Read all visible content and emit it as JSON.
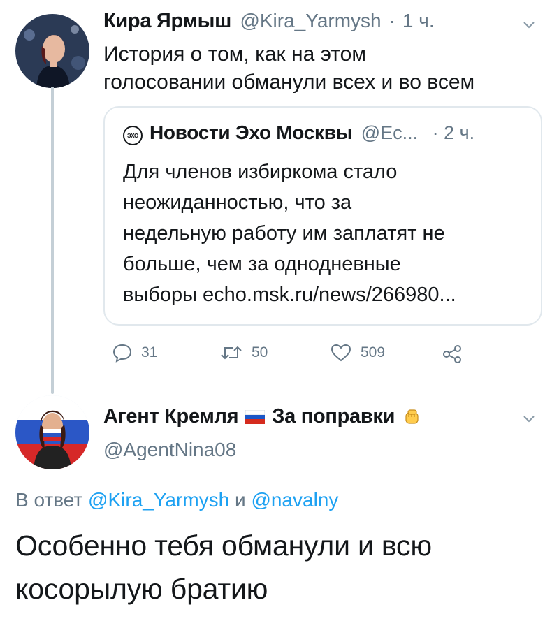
{
  "colors": {
    "accent": "#1da1f2",
    "muted": "#657786",
    "line": "#c4cfd6",
    "border": "#e1e8ed"
  },
  "tweet1": {
    "author_name": "Кира Ярмыш",
    "handle": "@Kira_Yarmysh",
    "dot": "·",
    "time": "1 ч.",
    "text_line1": "История о том, как на этом",
    "text_line2": "голосовании обманули всех и во всем",
    "quoted": {
      "logo_text": "ЭХО",
      "author_name": "Новости Эхо Москвы",
      "handle": "@Ec...",
      "time": "· 2 ч.",
      "lines": [
        "Для членов избиркома стало",
        "неожиданностью, что за",
        "недельную работу им заплатят не",
        "больше, чем за однодневные",
        "выборы echo.msk.ru/news/266980..."
      ]
    },
    "actions": {
      "replies": "31",
      "retweets": "50",
      "likes": "509"
    }
  },
  "tweet2": {
    "author_name_part1": "Агент Кремля",
    "author_name_part2": "За поправки",
    "handle": "@AgentNina08",
    "reply_prefix": "В ответ",
    "reply_handle1": "@Kira_Yarmysh",
    "reply_and": "и",
    "reply_handle2": "@navalny",
    "text_line1": "Особенно тебя обманули и всю",
    "text_line2": "косорылую братию"
  }
}
